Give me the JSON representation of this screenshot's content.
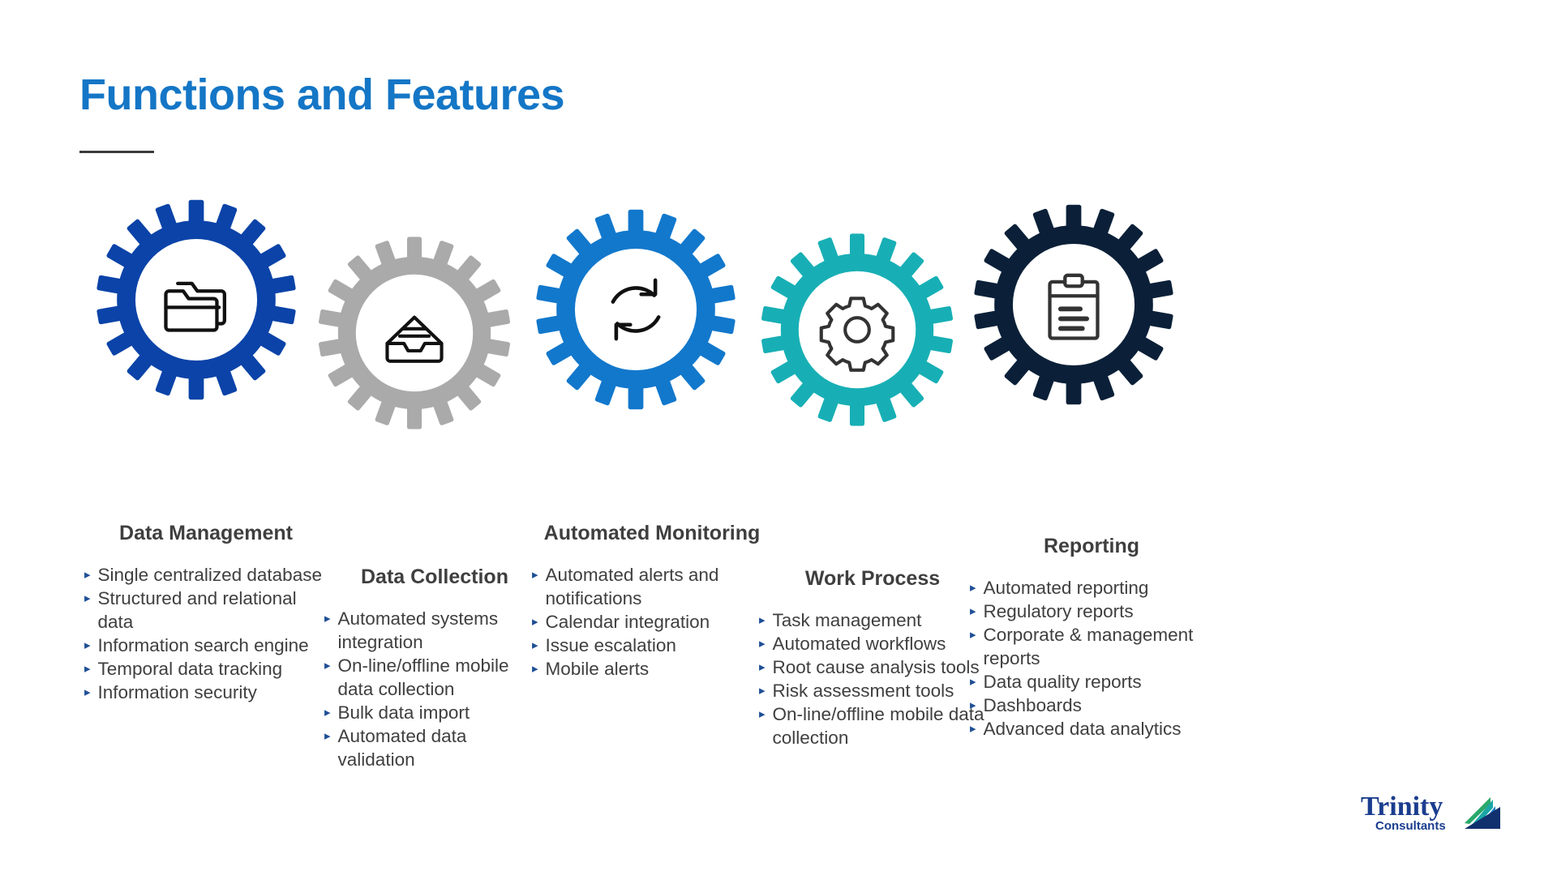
{
  "slide": {
    "title": "Functions and Features",
    "title_color": "#1476c6",
    "background": "#ffffff",
    "heading_color": "#3f3f3f",
    "bullet_marker_color": "#1f4f96",
    "bullet_marker_glyph": "▸"
  },
  "columns": [
    {
      "heading": "Data Management",
      "gear_color": "#0b43a8",
      "icon": "folders-icon",
      "bullets": [
        "Single centralized database",
        "Structured and relational data",
        "Information search engine",
        "Temporal data tracking",
        "Information security"
      ]
    },
    {
      "heading": "Data Collection",
      "gear_color": "#aaaaaa",
      "icon": "inbox-tray-icon",
      "bullets": [
        "Automated systems integration",
        "On-line/offline mobile data collection",
        "Bulk data import",
        "Automated data validation"
      ]
    },
    {
      "heading": "Automated Monitoring",
      "gear_color": "#1278cc",
      "icon": "refresh-sync-icon",
      "bullets": [
        "Automated alerts and notifications",
        "Calendar integration",
        "Issue escalation",
        "Mobile alerts"
      ]
    },
    {
      "heading": "Work Process",
      "gear_color": "#17afb5",
      "icon": "gear-cog-icon",
      "bullets": [
        "Task management",
        "Automated workflows",
        "Root cause analysis tools",
        "Risk assessment tools",
        "On-line/offline mobile data collection"
      ]
    },
    {
      "heading": "Reporting",
      "gear_color": "#0b2038",
      "icon": "clipboard-icon",
      "bullets": [
        "Automated reporting",
        "Regulatory reports",
        "Corporate & management reports",
        "Data quality reports",
        "Dashboards",
        "Advanced data analytics"
      ]
    }
  ],
  "logo": {
    "name": "Trinity",
    "tagline": "Consultants",
    "word_color": "#1b3d8f",
    "tagline_color": "#1b3d8f",
    "fan_colors": [
      "#2aa86a",
      "#1aa6a6",
      "#1f7ec4",
      "#1b4fa0",
      "#11306e"
    ]
  }
}
